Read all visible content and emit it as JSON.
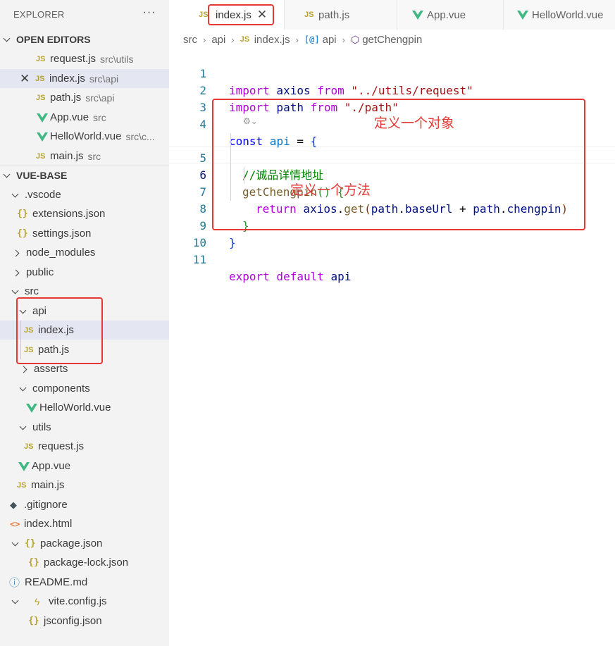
{
  "explorer": {
    "title": "EXPLORER",
    "more": "···"
  },
  "open_editors": {
    "title": "OPEN EDITORS",
    "items": [
      {
        "name": "request.js",
        "desc": "src\\utils",
        "icon": "js-icon"
      },
      {
        "name": "index.js",
        "desc": "src\\api",
        "icon": "js-icon"
      },
      {
        "name": "path.js",
        "desc": "src\\api",
        "icon": "js-icon"
      },
      {
        "name": "App.vue",
        "desc": "src",
        "icon": "vue-icon"
      },
      {
        "name": "HelloWorld.vue",
        "desc": "src\\c...",
        "icon": "vue-icon"
      },
      {
        "name": "main.js",
        "desc": "src",
        "icon": "js-icon"
      }
    ]
  },
  "project": {
    "title": "VUE-BASE",
    "tree": [
      ".vscode",
      "extensions.json",
      "settings.json",
      "node_modules",
      "public",
      "src",
      "api",
      "index.js",
      "path.js",
      "asserts",
      "components",
      "HelloWorld.vue",
      "utils",
      "request.js",
      "App.vue",
      "main.js",
      ".gitignore",
      "index.html",
      "package.json",
      "package-lock.json",
      "README.md",
      "vite.config.js",
      "jsconfig.json"
    ]
  },
  "tabs": [
    {
      "label": "index.js",
      "icon": "js-icon",
      "active": true
    },
    {
      "label": "path.js",
      "icon": "js-icon"
    },
    {
      "label": "App.vue",
      "icon": "vue-icon"
    },
    {
      "label": "HelloWorld.vue",
      "icon": "vue-icon"
    }
  ],
  "breadcrumb": [
    "src",
    "api",
    "index.js",
    "api",
    "getChengpin"
  ],
  "code": {
    "line_numbers": [
      "1",
      "2",
      "3",
      "4",
      "5",
      "6",
      "7",
      "8",
      "9",
      "10",
      "11"
    ],
    "l1": {
      "kw": "import",
      "id": " axios ",
      "from": "from",
      "str": " \"../utils/request\""
    },
    "l2": {
      "kw": "import",
      "id": " path ",
      "from": "from",
      "str": " \"./path\""
    },
    "l4": {
      "kw": "const",
      "id": " api",
      "op": " = ",
      "brace": "{"
    },
    "l5": {
      "comment": "//诚品详情地址"
    },
    "l6": {
      "fn": "getChengpin",
      "paren": "()",
      "sp": " ",
      "brace": "{"
    },
    "l7": {
      "kw": "return",
      "obj": " axios",
      "dot": ".",
      "fn": "get",
      "p1": "(",
      "a": "path",
      "d1": ".",
      "b": "baseUrl",
      "plus": " + ",
      "c": "path",
      "d2": ".",
      "e": "chengpin",
      "p2": ")"
    },
    "l8": {
      "brace": "}"
    },
    "l9": {
      "brace": "}"
    },
    "l11": {
      "kw1": "export",
      "kw2": " default",
      "id": " api"
    }
  },
  "annotations": {
    "object_label": "定义一个对象",
    "method_label": "定义一个方法",
    "color": "#e53935"
  }
}
